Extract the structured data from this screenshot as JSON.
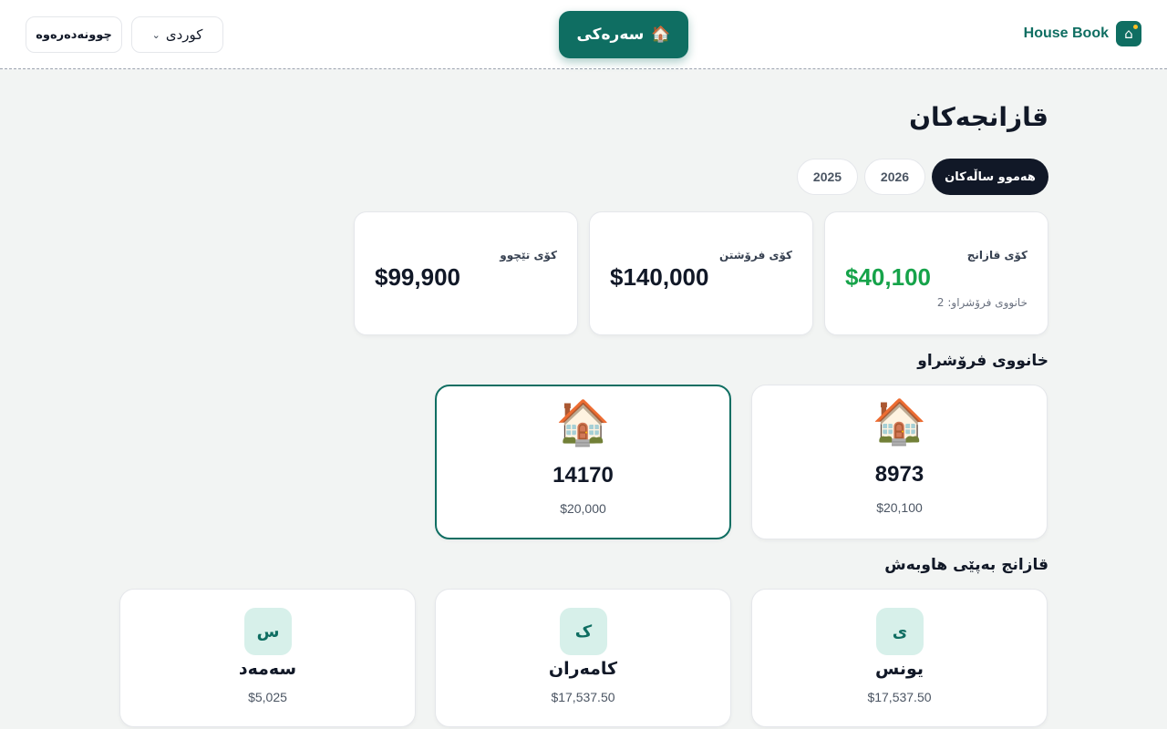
{
  "header": {
    "brand_name": "House Book",
    "brand_icon": "house-icon",
    "home_button": {
      "icon": "🏠",
      "label": "سەرەکی"
    },
    "language_select": {
      "value": "کوردی",
      "icon": "chevron-down-icon"
    },
    "logout_label": "چوونەدەرەوە"
  },
  "page": {
    "title": "قازانجەکان",
    "year_filters": [
      {
        "label": "هەموو ساڵەکان",
        "active": true
      },
      {
        "label": "2026",
        "active": false
      },
      {
        "label": "2025",
        "active": false
      }
    ]
  },
  "stats": {
    "total_profit": {
      "label": "کۆی قازانج",
      "value": "$40,100",
      "sub": "خانووی فرۆشراو: 2",
      "color": "#16a34a"
    },
    "total_sales": {
      "label": "کۆی فرۆشتن",
      "value": "$140,000"
    },
    "total_cost": {
      "label": "کۆی تێچوو",
      "value": "$99,900"
    }
  },
  "sold_houses": {
    "title": "خانووی فرۆشراو",
    "items": [
      {
        "icon": "🏠",
        "number": "8973",
        "amount": "$20,100"
      },
      {
        "icon": "🏠",
        "number": "14170",
        "amount": "$20,000"
      }
    ]
  },
  "partners": {
    "title": "قازانج بەپێی هاوبەش",
    "items": [
      {
        "initial": "ی",
        "name": "یونس",
        "amount": "$17,537.50"
      },
      {
        "initial": "ک",
        "name": "کامەران",
        "amount": "$17,537.50"
      },
      {
        "initial": "س",
        "name": "سەمەد",
        "amount": "$5,025"
      }
    ]
  },
  "colors": {
    "primary": "#0f6e62",
    "dark": "#111827",
    "profit": "#16a34a",
    "background": "#f2f4f3"
  }
}
